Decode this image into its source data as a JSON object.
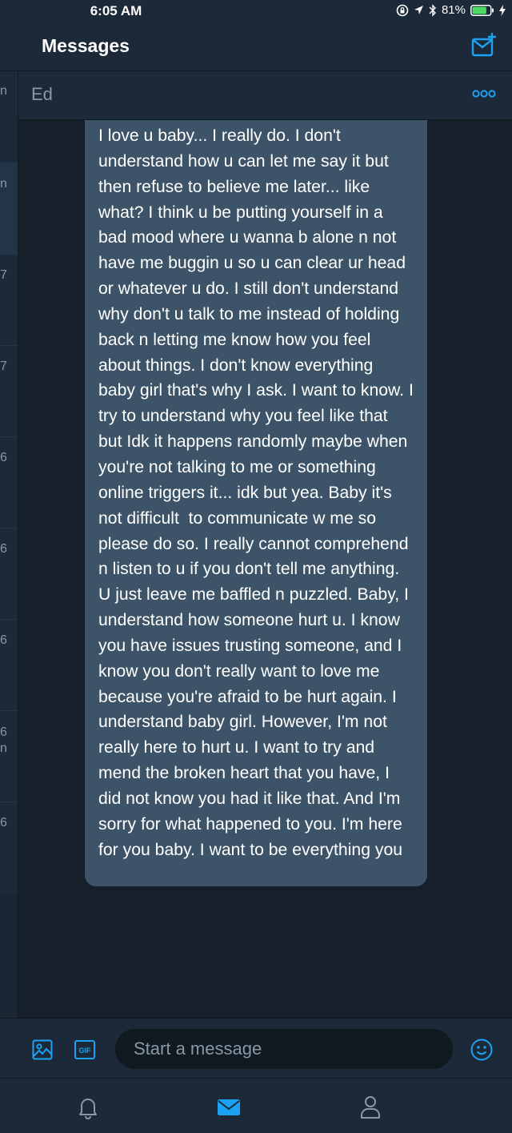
{
  "status_bar": {
    "time": "6:05 AM",
    "battery_percent": "81%",
    "battery_level": 0.81
  },
  "header": {
    "title": "Messages"
  },
  "left_strip": {
    "chars": [
      "n",
      "n",
      "7",
      "7",
      "6",
      "6",
      "6",
      "6\nn",
      "6"
    ]
  },
  "conversation": {
    "name": "Ed",
    "message": "I love u baby... I really do. I don't understand how u can let me say it but then refuse to believe me later... like what? I think u be putting yourself in a bad mood where u wanna b alone n not have me buggin u so u can clear ur head or whatever u do. I still don't understand why don't u talk to me instead of holding back n letting me know how you feel about things. I don't know everything baby girl that's why I ask. I want to know. I try to understand why you feel like that but Idk it happens randomly maybe when you're not talking to me or something online triggers it... idk but yea. Baby it's not difficult  to communicate w me so please do so. I really cannot comprehend n listen to u if you don't tell me anything. U just leave me baffled n puzzled. Baby, I understand how someone hurt u. I know you have issues trusting someone, and I know you don't really want to love me because you're afraid to be hurt again. I understand baby girl. However, I'm not really here to hurt u. I want to try and mend the broken heart that you have, I did not know you had it like that. And I'm sorry for what happened to you. I'm here for you baby. I want to be everything you"
  },
  "composer": {
    "placeholder": "Start a message",
    "gif_label": "GIF"
  },
  "colors": {
    "accent": "#1da1f2",
    "background": "#15202b",
    "panel": "#1c2938",
    "bubble": "#3d5468",
    "muted": "#8899a6"
  },
  "icons": [
    "compose-icon",
    "more-icon",
    "media-icon",
    "gif-icon",
    "emoji-icon",
    "bell-icon",
    "mail-icon",
    "profile-icon"
  ]
}
